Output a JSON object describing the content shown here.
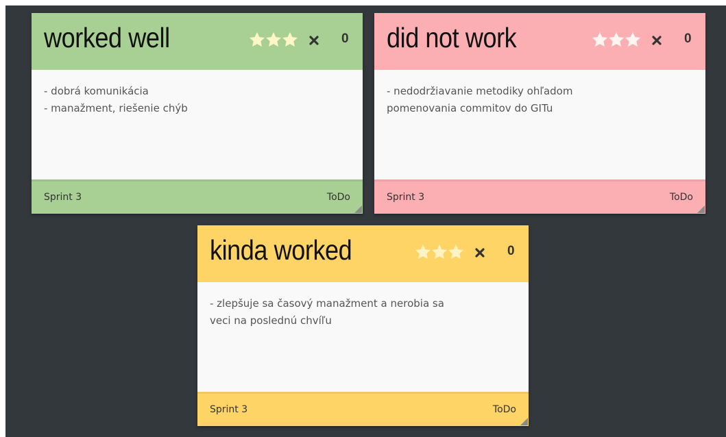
{
  "colors": {
    "board_background": "#33383d",
    "green": "#a8cf94",
    "red": "#fcafb3",
    "yellow": "#ffd466",
    "body": "#f9f9f9",
    "star": "#fff6c8"
  },
  "icons": {
    "rating": "star-icon",
    "delete": "close-icon",
    "resize": "resize-handle-icon"
  },
  "cards": [
    {
      "title": "worked well",
      "color": "green",
      "rating_stars": 3,
      "votes": "0",
      "lines": [
        "- dobrá komunikácia",
        "- manažment, riešenie chýb"
      ],
      "sprint": "Sprint 3",
      "status": "ToDo"
    },
    {
      "title": "did not work",
      "color": "red",
      "rating_stars": 3,
      "votes": "0",
      "lines": [
        "- nedodržiavanie metodiky ohľadom",
        "pomenovania commitov do GITu"
      ],
      "sprint": "Sprint 3",
      "status": "ToDo"
    },
    {
      "title": "kinda worked",
      "color": "yellow",
      "rating_stars": 3,
      "votes": "0",
      "lines": [
        "- zlepšuje sa časový manažment a nerobia sa",
        "veci na poslednú chvíľu"
      ],
      "sprint": "Sprint 3",
      "status": "ToDo"
    }
  ]
}
